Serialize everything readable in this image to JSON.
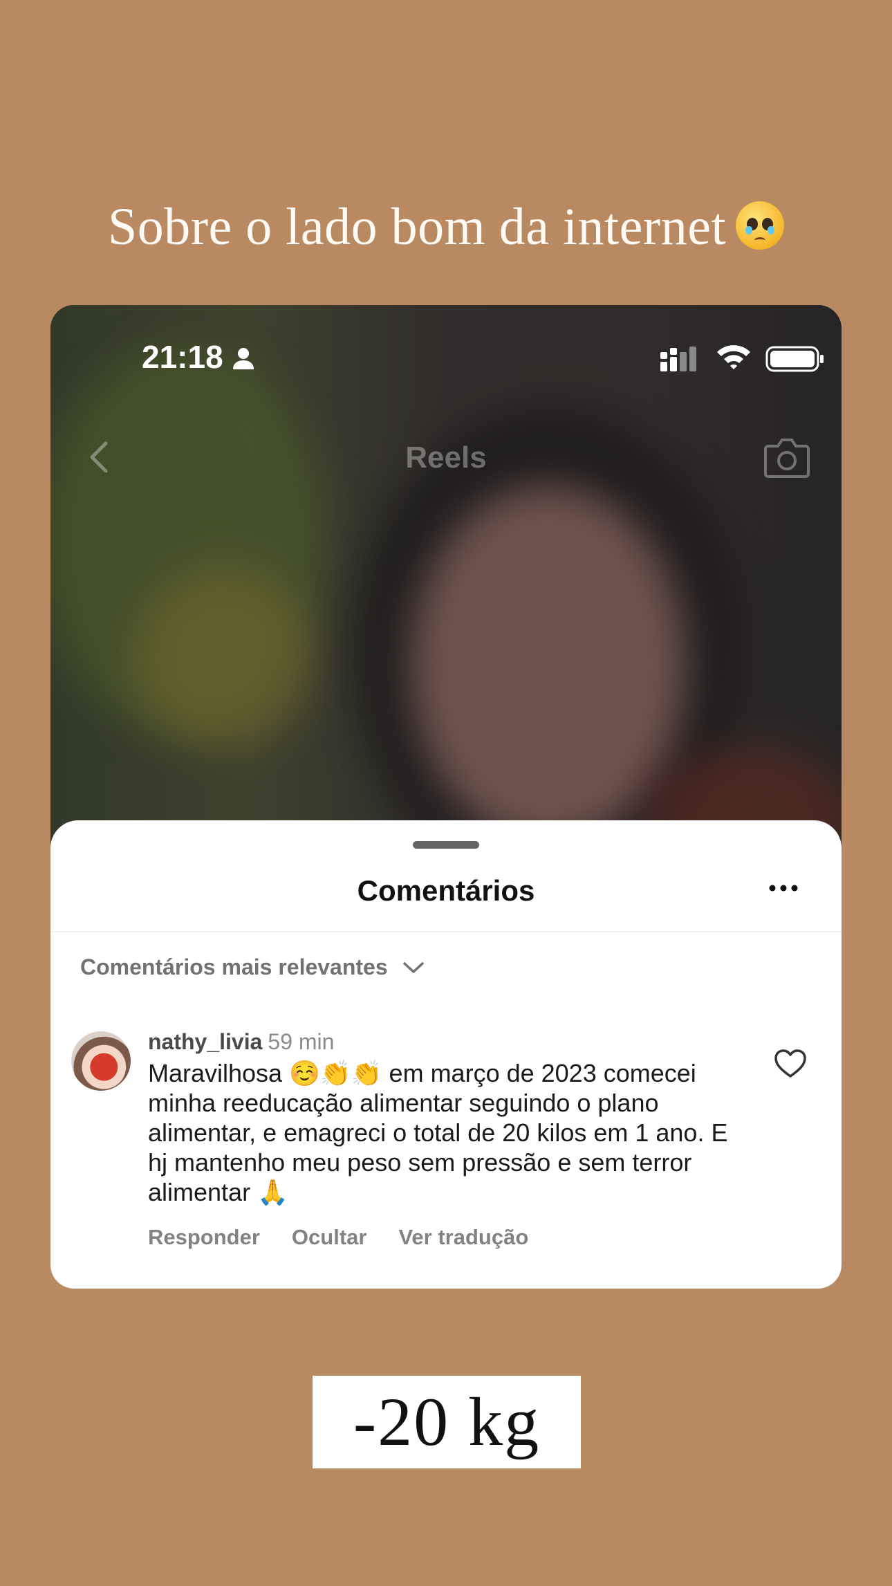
{
  "story": {
    "title": "Sobre o lado bom da internet",
    "title_emoji": "pleading-face-tears-emoji",
    "sticker_text": "-20 kg",
    "background_color": "#b98a61"
  },
  "status_bar": {
    "time": "21:18"
  },
  "header": {
    "title": "Reels"
  },
  "comments_sheet": {
    "title": "Comentários",
    "sort_label": "Comentários mais relevantes",
    "comment": {
      "username": "nathy_livia",
      "time_ago": "59 min",
      "text": "Maravilhosa ☺️👏👏 em março de 2023 comecei minha reeducação alimentar seguindo o plano alimentar, e emagreci o total de 20 kilos em 1 ano. E hj mantenho meu peso sem pressão e sem terror alimentar 🙏",
      "actions": {
        "reply": "Responder",
        "hide": "Ocultar",
        "translate": "Ver tradução"
      }
    }
  }
}
